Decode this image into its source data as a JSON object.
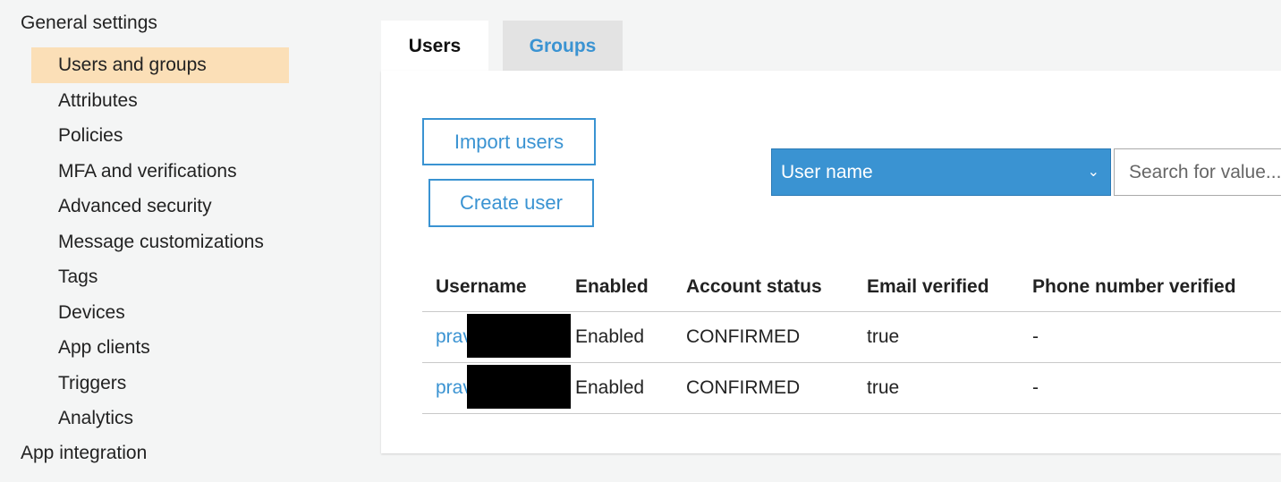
{
  "sidebar": {
    "general_settings": "General settings",
    "items": [
      {
        "label": "Users and groups"
      },
      {
        "label": "Attributes"
      },
      {
        "label": "Policies"
      },
      {
        "label": "MFA and verifications"
      },
      {
        "label": "Advanced security"
      },
      {
        "label": "Message customizations"
      },
      {
        "label": "Tags"
      },
      {
        "label": "Devices"
      },
      {
        "label": "App clients"
      },
      {
        "label": "Triggers"
      },
      {
        "label": "Analytics"
      }
    ],
    "app_integration": "App integration",
    "active_color": "#fbdfb7"
  },
  "tabs": {
    "users": "Users",
    "groups": "Groups"
  },
  "actions": {
    "import_users": "Import users",
    "create_user": "Create user"
  },
  "filter": {
    "attribute": "User name",
    "search_placeholder": "Search for value..."
  },
  "table": {
    "headers": [
      "Username",
      "Enabled",
      "Account status",
      "Email verified",
      "Phone number verified"
    ],
    "rows": [
      {
        "username": "prav",
        "enabled": "Enabled",
        "status": "CONFIRMED",
        "email_verified": "true",
        "phone_verified": "-"
      },
      {
        "username": "prav",
        "enabled": "Enabled",
        "status": "CONFIRMED",
        "email_verified": "true",
        "phone_verified": "-"
      }
    ]
  },
  "colors": {
    "accent": "#3a93d2",
    "panel_bg": "#ffffff",
    "page_bg": "#f4f5f5"
  }
}
